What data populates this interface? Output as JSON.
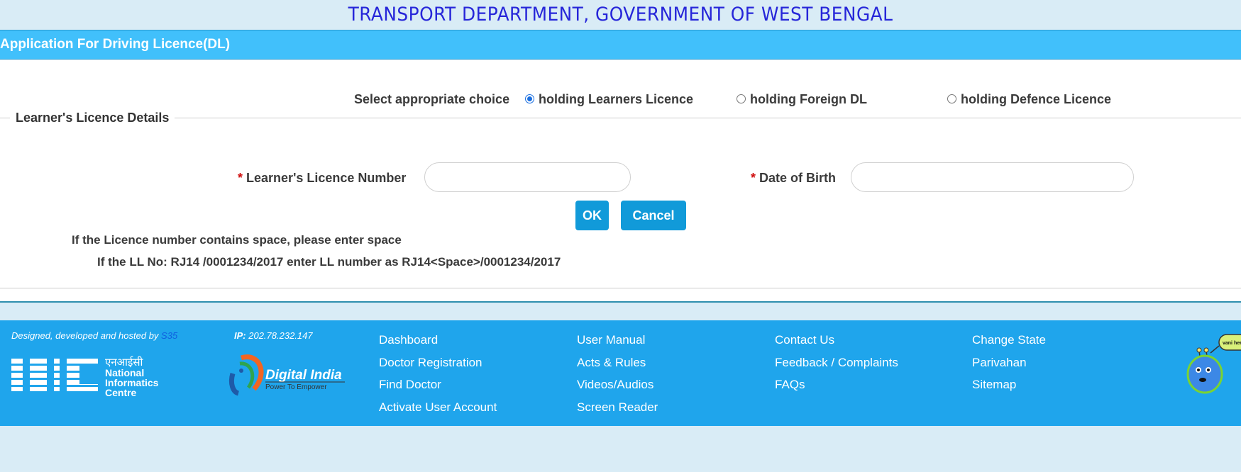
{
  "header": {
    "title": "TRANSPORT DEPARTMENT, GOVERNMENT OF WEST BENGAL"
  },
  "page": {
    "heading": "Application For Driving Licence(DL)"
  },
  "choice": {
    "label": "Select appropriate choice",
    "options": [
      {
        "label": "holding Learners Licence",
        "selected": true
      },
      {
        "label": "holding Foreign DL",
        "selected": false
      },
      {
        "label": "holding Defence Licence",
        "selected": false
      }
    ]
  },
  "section": {
    "legend": "Learner's Licence Details"
  },
  "form": {
    "required_mark": "*",
    "ll_number_label": "Learner's Licence Number",
    "ll_number_value": "",
    "dob_label": "Date of Birth",
    "dob_value": "",
    "ok_label": "OK",
    "cancel_label": "Cancel"
  },
  "hints": {
    "line1": "If the Licence number contains space, please enter space",
    "line2": "If the LL No: RJ14 /0001234/2017 enter LL number as RJ14<Space>/0001234/2017"
  },
  "footer": {
    "credit_prefix": "Designed, developed and hosted by ",
    "credit_link": "S35",
    "ip_label": "IP:",
    "ip_value": " 202.78.232.147",
    "nic_hindi": "एनआईसी",
    "nic_line1": "National",
    "nic_line2": "Informatics",
    "nic_line3": "Centre",
    "digital_india": "Digital India",
    "digital_india_tag": "Power To Empower",
    "mascot_bubble": "vani here",
    "columns": [
      [
        "Dashboard",
        "Doctor Registration",
        "Find Doctor",
        "Activate User Account"
      ],
      [
        "User Manual",
        "Acts & Rules",
        "Videos/Audios",
        "Screen Reader"
      ],
      [
        "Contact Us",
        "Feedback / Complaints",
        "FAQs"
      ],
      [
        "Change State",
        "Parivahan",
        "Sitemap"
      ]
    ]
  },
  "colors": {
    "header_bar": "#41c0fb",
    "footer": "#1fa5ec",
    "button": "#119ad9",
    "title": "#2626d9"
  }
}
